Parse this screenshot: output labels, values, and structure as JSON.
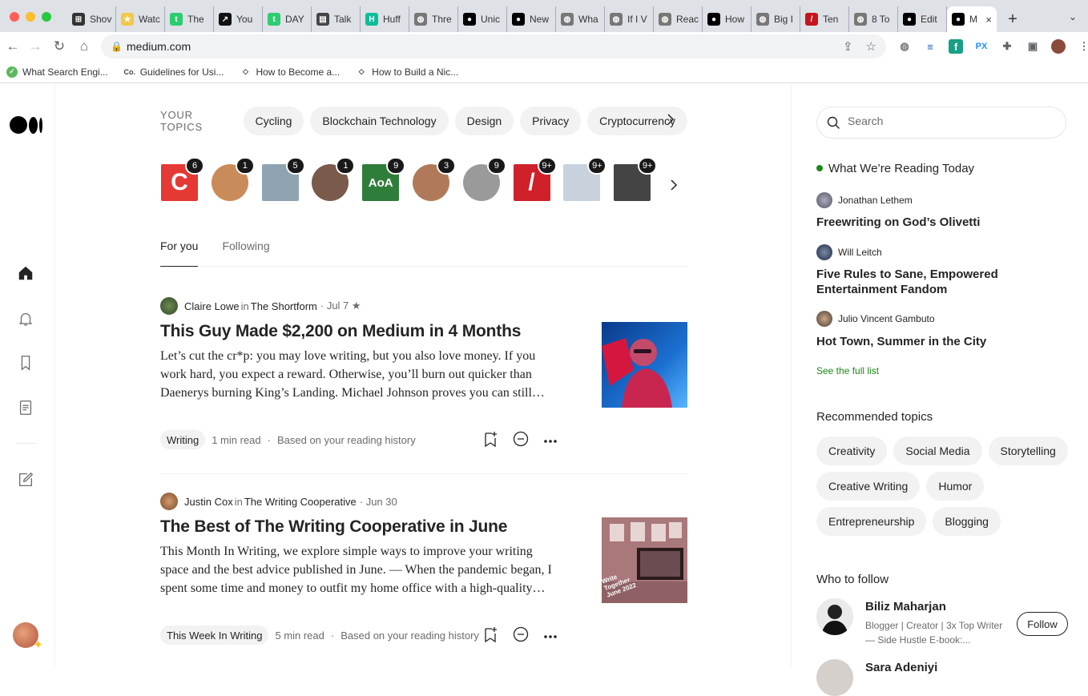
{
  "browser": {
    "tabs": [
      {
        "label": "Shov",
        "color": "#333333",
        "glyph": "⊞"
      },
      {
        "label": "Watc",
        "color": "#f2c94c",
        "glyph": "★"
      },
      {
        "label": "The",
        "color": "#2ecc71",
        "glyph": "t"
      },
      {
        "label": "You",
        "color": "#111111",
        "glyph": "↗"
      },
      {
        "label": "DAY",
        "color": "#2ecc71",
        "glyph": "t"
      },
      {
        "label": "Talk",
        "color": "#444444",
        "glyph": "▤"
      },
      {
        "label": "Huff",
        "color": "#0dbe98",
        "glyph": "H"
      },
      {
        "label": "Thre",
        "color": "#777777",
        "glyph": "◍"
      },
      {
        "label": "Unic",
        "color": "#000000",
        "glyph": "●"
      },
      {
        "label": "New",
        "color": "#000000",
        "glyph": "●"
      },
      {
        "label": "Wha",
        "color": "#777777",
        "glyph": "◍"
      },
      {
        "label": "If I V",
        "color": "#777777",
        "glyph": "◍"
      },
      {
        "label": "Reac",
        "color": "#777777",
        "glyph": "◍"
      },
      {
        "label": "How",
        "color": "#000000",
        "glyph": "●"
      },
      {
        "label": "Big I",
        "color": "#777777",
        "glyph": "◍"
      },
      {
        "label": "Ten",
        "color": "#c4161c",
        "glyph": "/"
      },
      {
        "label": "8 To",
        "color": "#777777",
        "glyph": "◍"
      },
      {
        "label": "Edit",
        "color": "#000000",
        "glyph": "●"
      }
    ],
    "active_tab": {
      "label": "M",
      "close": "×"
    },
    "new_tab": "+",
    "url": "medium.com",
    "bookmarks": [
      {
        "label": "What Search Engi...",
        "color": "#5cb85c",
        "glyph": "✓"
      },
      {
        "label": "Guidelines for Usi...",
        "color": "#ffffff",
        "glyph": "Co."
      },
      {
        "label": "How to Become a...",
        "color": "#ffffff",
        "glyph": "◇"
      },
      {
        "label": "How to Build a Nic...",
        "color": "#ffffff",
        "glyph": "◇"
      }
    ]
  },
  "topics": {
    "label": "YOUR TOPICS",
    "items": [
      "Cycling",
      "Blockchain Technology",
      "Design",
      "Privacy",
      "Cryptocurrency"
    ]
  },
  "publications": [
    {
      "badge": "6",
      "color": "#e53935",
      "shape": "sq",
      "glyph": "C"
    },
    {
      "badge": "1",
      "color": "#c98b5a",
      "shape": "round",
      "glyph": ""
    },
    {
      "badge": "5",
      "color": "#8fa3b3",
      "shape": "sq",
      "glyph": ""
    },
    {
      "badge": "1",
      "color": "#7a5a4a",
      "shape": "round",
      "glyph": ""
    },
    {
      "badge": "9",
      "color": "#2f7d3a",
      "shape": "sq",
      "glyph": "AoA"
    },
    {
      "badge": "3",
      "color": "#b07a5a",
      "shape": "round",
      "glyph": ""
    },
    {
      "badge": "9",
      "color": "#9a9a9a",
      "shape": "round",
      "glyph": ""
    },
    {
      "badge": "9+",
      "color": "#d0202a",
      "shape": "sq",
      "glyph": "/"
    },
    {
      "badge": "9+",
      "color": "#c8d2dc",
      "shape": "sq",
      "glyph": ""
    },
    {
      "badge": "9+",
      "color": "#444444",
      "shape": "sq",
      "glyph": ""
    }
  ],
  "feed_tabs": {
    "for_you": "For you",
    "following": "Following"
  },
  "articles": [
    {
      "author": "Claire Lowe",
      "in": "in",
      "publication": "The Shortform",
      "date": "· Jul 7 ★",
      "title": "This Guy Made $2,200 on Medium in 4 Months",
      "subtitle": "Let’s cut the cr*p: you may love writing, but you also love money. If you work hard, you expect a reward. Otherwise, you’ll burn out quicker than Daenerys burning King’s Landing. Michael Johnson proves you can still…",
      "tag": "Writing",
      "read_time": "1 min read",
      "dot": "·",
      "reason": "Based on your reading history"
    },
    {
      "author": "Justin Cox",
      "in": "in",
      "publication": "The Writing Cooperative",
      "date": "· Jun 30",
      "title": "The Best of The Writing Cooperative in June",
      "subtitle": "This Month In Writing, we explore simple ways to improve your writing space and the best advice published in June. — When the pandemic began, I spent some time and money to outfit my home office with a high-quality…",
      "tag": "This Week In Writing",
      "read_time": "5 min read",
      "dot": "·",
      "reason": "Based on your reading history",
      "thumb_text": "Write Together June 2022"
    }
  ],
  "sidebar": {
    "search_placeholder": "Search",
    "reading_today": "What We’re Reading Today",
    "picks": [
      {
        "author": "Jonathan Lethem",
        "title": "Freewriting on God’s Olivetti"
      },
      {
        "author": "Will Leitch",
        "title": "Five Rules to Sane, Empowered Entertainment Fandom"
      },
      {
        "author": "Julio Vincent Gambuto",
        "title": "Hot Town, Summer in the City"
      }
    ],
    "see_full_list": "See the full list",
    "recommended_topics_title": "Recommended topics",
    "recommended_topics": [
      "Creativity",
      "Social Media",
      "Storytelling",
      "Creative Writing",
      "Humor",
      "Entrepreneurship",
      "Blogging"
    ],
    "who_to_follow_title": "Who to follow",
    "follow_suggestion": {
      "name": "Biliz Maharjan",
      "bio": "Blogger | Creator | 3x Top Writer — Side Hustle E-book:...",
      "button": "Follow"
    },
    "next_suggestion_name": "Sara Adeniyi"
  },
  "colors": {
    "accent_green": "#1a8917",
    "text": "#242424",
    "muted": "#6b6b6b"
  }
}
